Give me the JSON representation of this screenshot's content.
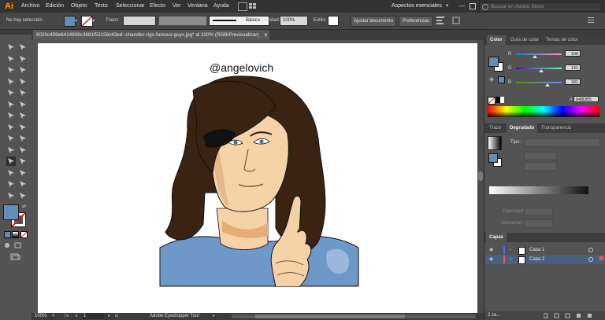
{
  "app": {
    "logo": "Ai"
  },
  "menu": [
    "Archivo",
    "Edición",
    "Objeto",
    "Texto",
    "Seleccionar",
    "Efecto",
    "Ver",
    "Ventana",
    "Ayuda"
  ],
  "workspace": {
    "label": "Aspectos esenciales",
    "search_placeholder": "Buscar en Adobe Stock"
  },
  "control_bar": {
    "selection_status": "No hay selección",
    "stroke_label": "Trazo:",
    "brush_label": "Básico",
    "opacity_label": "Opacidad:",
    "opacity_value": "100%",
    "style_label": "Estilo:",
    "doc_setup_button": "Ajustar documento",
    "preferences_button": "Preferencias"
  },
  "document": {
    "tab_title": "8020c459e6414908c3681f53156c43ed--chandler-rigs-famous-guys.jpg* al 100% (RGB/Previsualizar)",
    "close_glyph": "×",
    "artwork_text": "@angelovich"
  },
  "status_bar": {
    "zoom": "100%",
    "artboard_number": "1",
    "tool_name": "Adobe Eyedropper Tool"
  },
  "color_panel": {
    "tabs": [
      "Color",
      "Guía de color",
      "Temas de color"
    ],
    "active_tab": 0,
    "channels": [
      {
        "label": "R",
        "value": "100"
      },
      {
        "label": "G",
        "value": "141"
      },
      {
        "label": "B",
        "value": "181"
      }
    ],
    "hex_label": "#",
    "hex_value": "648DB5",
    "current_color": "#648DB5"
  },
  "gradient_panel": {
    "tabs": [
      "Trazo",
      "Degradado",
      "Transparencia"
    ],
    "active_tab": 1,
    "type_label": "Tipo:",
    "opacity_label": "Opacidad:",
    "location_label": "Ubicación:"
  },
  "layers_panel": {
    "title": "Capas",
    "layers": [
      {
        "name": "Capa 1",
        "selected": false,
        "color": "#4f6bff"
      },
      {
        "name": "Capa 2",
        "selected": true,
        "color": "#ff4f4f"
      }
    ],
    "count_label": "2 ca..."
  },
  "colors": {
    "fill": "#648DB5",
    "hair": "#3b2314",
    "skin": "#f6d3a6",
    "shirt": "#6e98c8"
  }
}
